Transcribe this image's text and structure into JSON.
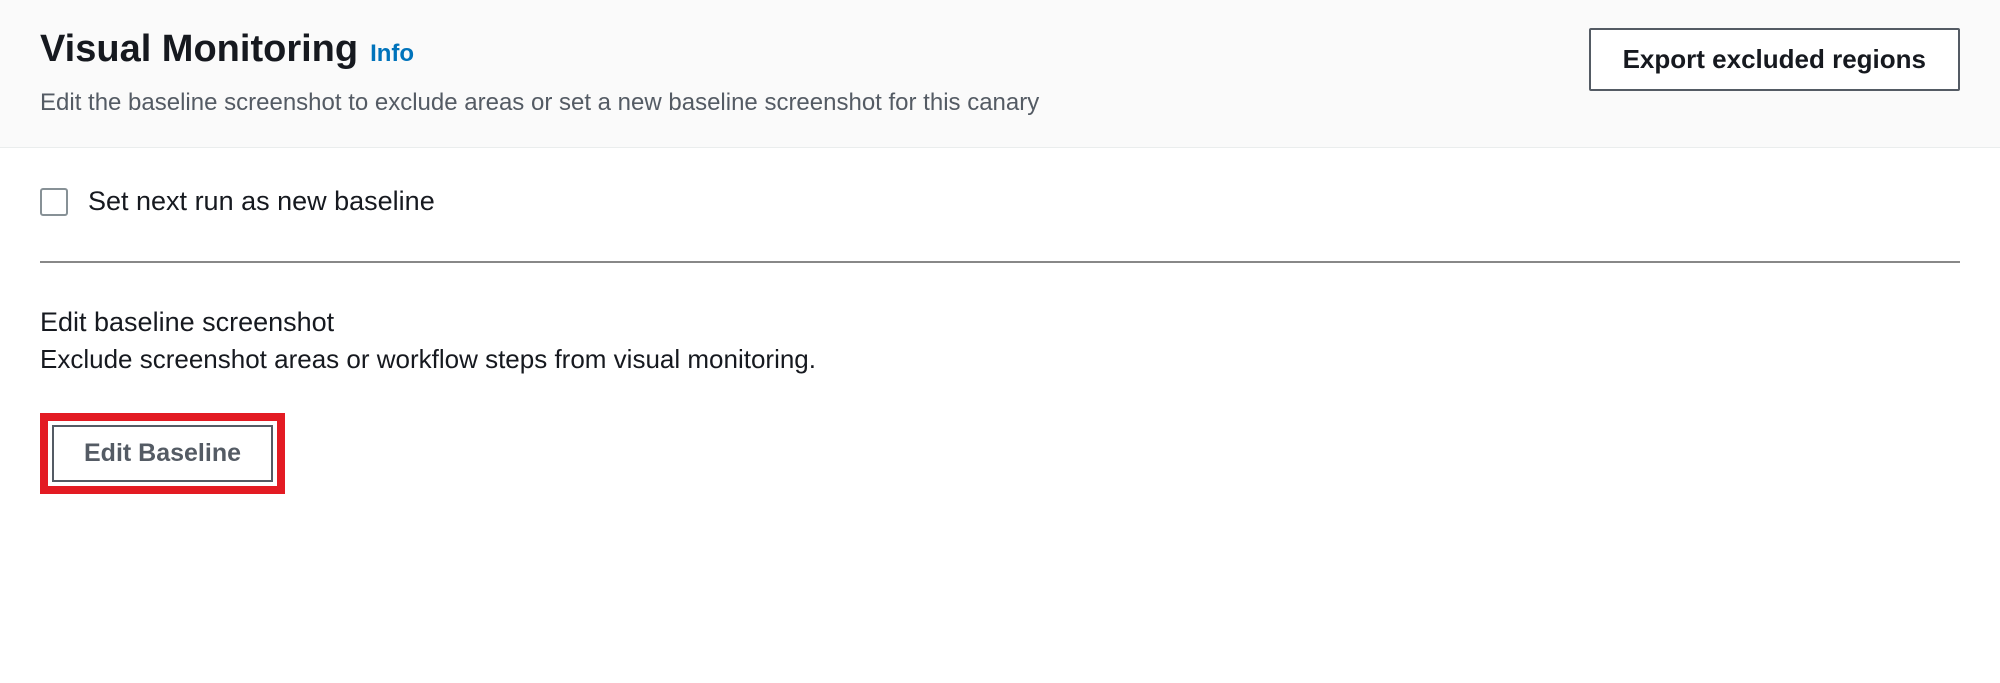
{
  "header": {
    "title": "Visual Monitoring",
    "info_label": "Info",
    "description": "Edit the baseline screenshot to exclude areas or set a new baseline screenshot for this canary",
    "export_button_label": "Export excluded regions"
  },
  "body": {
    "checkbox_label": "Set next run as new baseline",
    "edit_section": {
      "heading": "Edit baseline screenshot",
      "description": "Exclude screenshot areas or workflow steps from visual monitoring.",
      "button_label": "Edit Baseline"
    }
  }
}
